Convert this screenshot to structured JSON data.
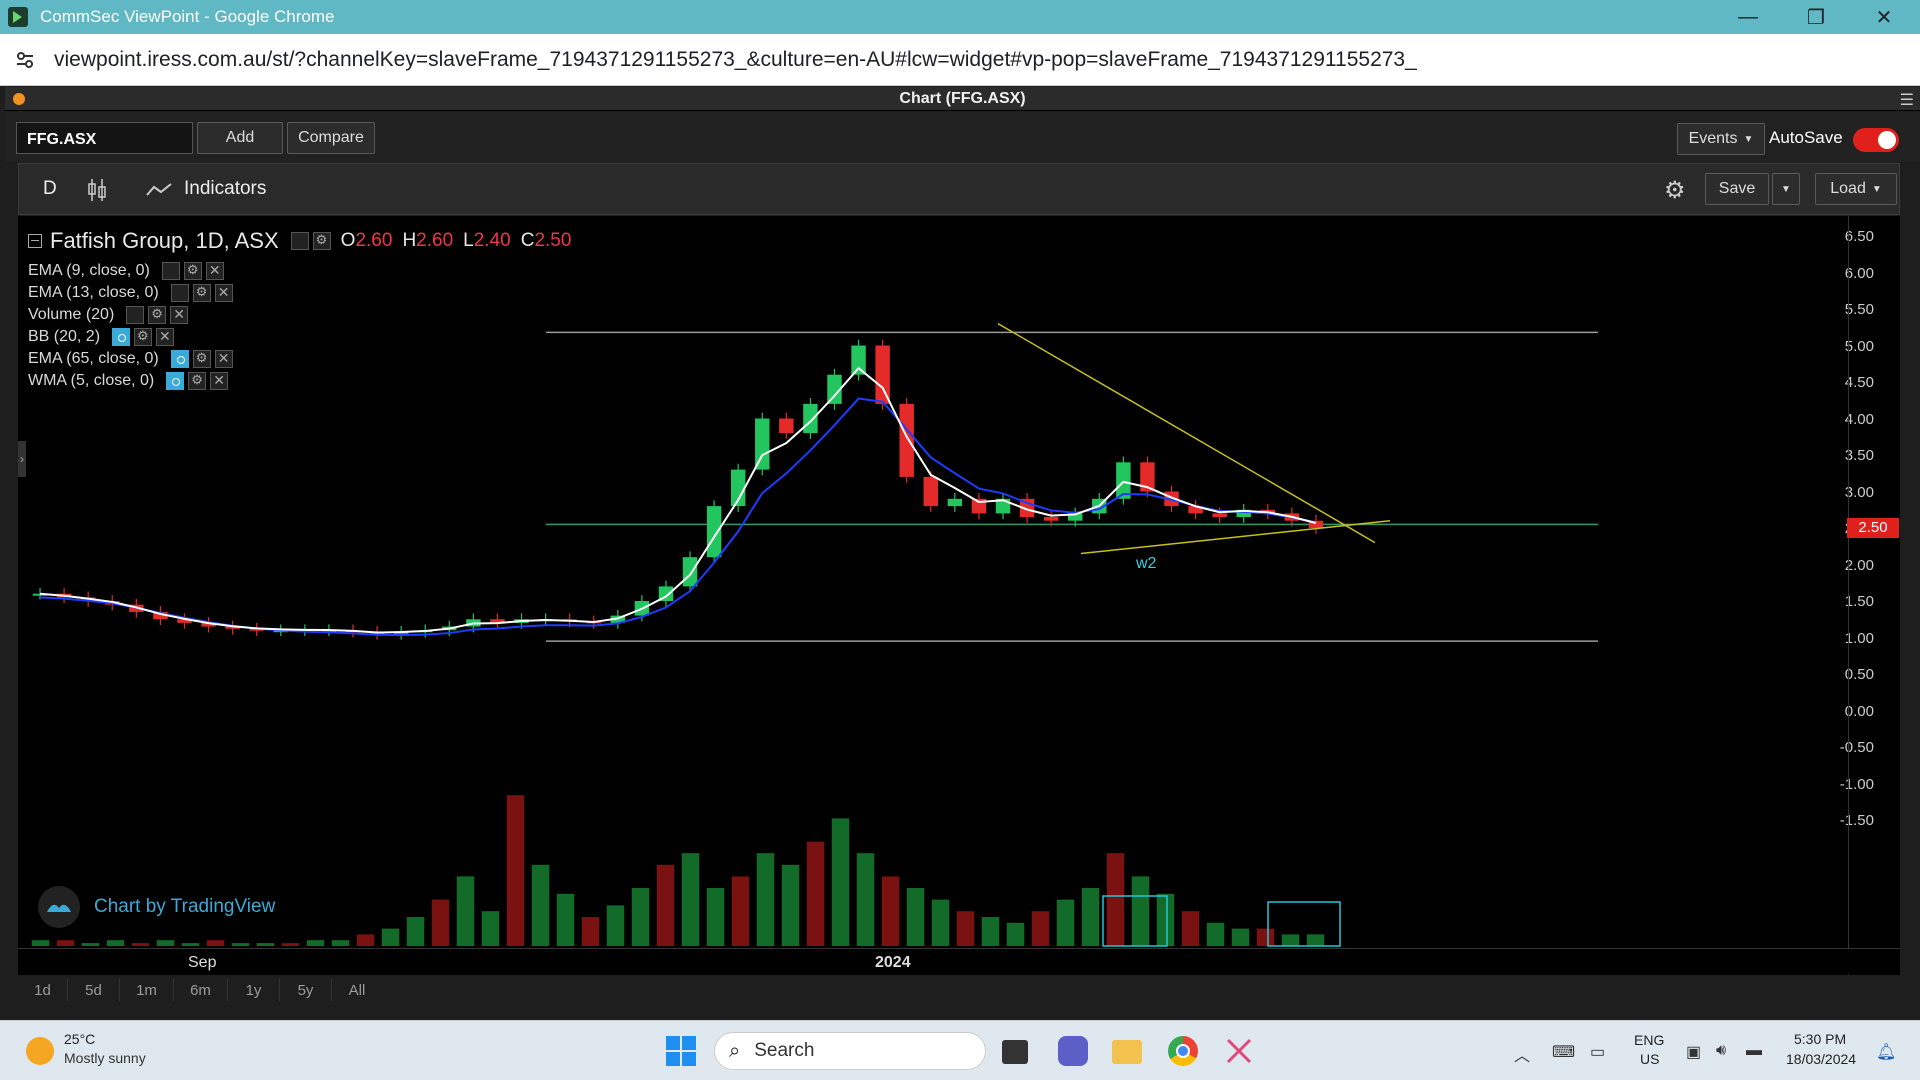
{
  "window": {
    "title": "CommSec ViewPoint - Google Chrome"
  },
  "browser": {
    "url": "viewpoint.iress.com.au/st/?channelKey=slaveFrame_7194371291155273_&culture=en-AU#lcw=widget#vp-pop=slaveFrame_7194371291155273_"
  },
  "panel": {
    "title": "Chart (FFG.ASX)"
  },
  "toolbar": {
    "symbol": "FFG.ASX",
    "add": "Add",
    "compare": "Compare",
    "events": "Events",
    "autosave": "AutoSave",
    "autosave_on": true
  },
  "chart_toolbar": {
    "interval": "D",
    "indicators": "Indicators",
    "save": "Save",
    "load": "Load"
  },
  "chart_header": {
    "name": "Fatfish Group, 1D, ASX",
    "o_label": "O",
    "o": "2.60",
    "h_label": "H",
    "h": "2.60",
    "l_label": "L",
    "l": "2.40",
    "c_label": "C",
    "c": "2.50"
  },
  "indicators": [
    {
      "label": "EMA (9, close, 0)",
      "active": false
    },
    {
      "label": "EMA (13, close, 0)",
      "active": false
    },
    {
      "label": "Volume (20)",
      "active": false
    },
    {
      "label": "BB (20, 2)",
      "active": true
    },
    {
      "label": "EMA (65, close, 0)",
      "active": true
    },
    {
      "label": "WMA (5, close, 0)",
      "active": true
    }
  ],
  "price_axis": [
    "6.50",
    "6.00",
    "5.50",
    "5.00",
    "4.50",
    "4.00",
    "3.50",
    "3.00",
    "2.50",
    "2.00",
    "1.50",
    "1.00",
    "0.50",
    "0.00",
    "-0.50",
    "-1.00",
    "-1.50"
  ],
  "last_price": "2.50",
  "annotation": "w2",
  "watermark": "Chart by TradingView",
  "time_axis": [
    "Sep",
    "2024"
  ],
  "ranges": [
    "1d",
    "5d",
    "1m",
    "6m",
    "1y",
    "5y",
    "All"
  ],
  "colors": {
    "up": "#22c55e",
    "down": "#e52a2a",
    "ema_blue": "#1e3cff",
    "wma_white": "#ffffff",
    "trendline": "#c8c020",
    "hline_gray": "#9a9a9a",
    "hline_green": "#2e9a6a",
    "box": "#22c8d8"
  },
  "taskbar": {
    "weather_temp": "25°C",
    "weather_text": "Mostly sunny",
    "search": "Search",
    "lang1": "ENG",
    "lang2": "US",
    "time": "5:30 PM",
    "date": "18/03/2024"
  },
  "chart_data": {
    "type": "candlestick",
    "title": "Fatfish Group, 1D, ASX",
    "ylim": [
      -1.5,
      6.5
    ],
    "x_labels": [
      "Sep",
      "2024"
    ],
    "closes_approx": [
      1.6,
      1.55,
      1.5,
      1.45,
      1.35,
      1.25,
      1.2,
      1.15,
      1.12,
      1.1,
      1.1,
      1.1,
      1.1,
      1.08,
      1.05,
      1.08,
      1.1,
      1.15,
      1.25,
      1.2,
      1.25,
      1.25,
      1.22,
      1.2,
      1.3,
      1.5,
      1.7,
      2.1,
      2.8,
      3.3,
      4.0,
      3.8,
      4.2,
      4.6,
      5.0,
      4.2,
      3.2,
      2.8,
      2.9,
      2.7,
      2.9,
      2.65,
      2.6,
      2.7,
      2.9,
      3.4,
      3.0,
      2.8,
      2.7,
      2.65,
      2.75,
      2.7,
      2.6,
      2.5
    ],
    "volume_approx": [
      0.1,
      0.1,
      0.05,
      0.1,
      0.05,
      0.1,
      0.05,
      0.1,
      0.05,
      0.05,
      0.05,
      0.1,
      0.1,
      0.2,
      0.3,
      0.5,
      0.8,
      1.2,
      0.6,
      2.6,
      1.4,
      0.9,
      0.5,
      0.7,
      1.0,
      1.4,
      1.6,
      1.0,
      1.2,
      1.6,
      1.4,
      1.8,
      2.2,
      1.6,
      1.2,
      1.0,
      0.8,
      0.6,
      0.5,
      0.4,
      0.6,
      0.8,
      1.0,
      1.6,
      1.2,
      0.9,
      0.6,
      0.4,
      0.3,
      0.3,
      0.2,
      0.2
    ]
  }
}
